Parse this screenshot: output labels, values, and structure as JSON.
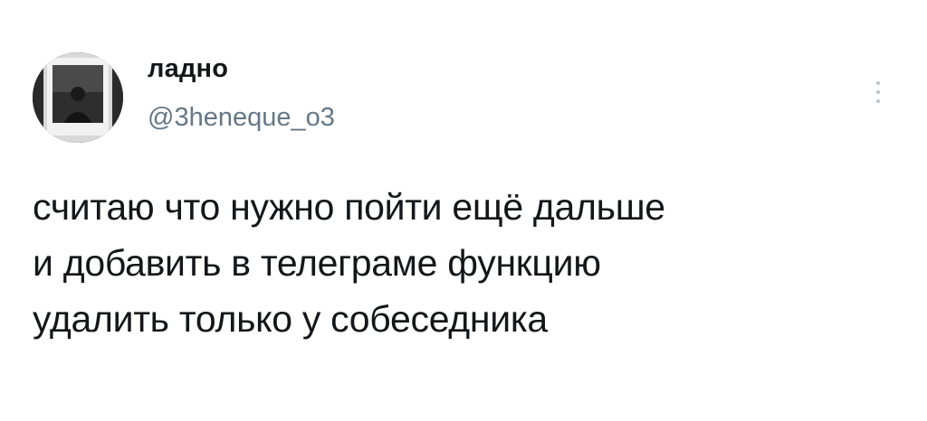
{
  "author": {
    "display_name": "ладно",
    "handle": "@3heneque_o3"
  },
  "tweet": {
    "lines": [
      "считаю что нужно пойти ещё дальше",
      "и добавить в телеграме функцию",
      "удалить только у собеседника"
    ]
  },
  "icons": {
    "more": "more-vertical-icon",
    "avatar": "avatar"
  },
  "colors": {
    "text_primary": "#14171a",
    "text_secondary": "#657786",
    "icon_muted": "#b9c2c9",
    "background": "#ffffff"
  }
}
